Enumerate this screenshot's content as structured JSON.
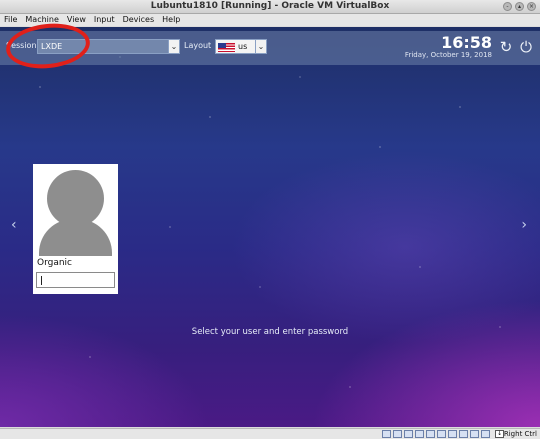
{
  "window": {
    "title": "Lubuntu1810 [Running] - Oracle VM VirtualBox"
  },
  "menubar": {
    "items": [
      "File",
      "Machine",
      "View",
      "Input",
      "Devices",
      "Help"
    ]
  },
  "login": {
    "session_label": "Session",
    "session_value": "LXDE",
    "layout_label": "Layout",
    "layout_value": "us",
    "clock_time": "16:58",
    "clock_date": "Friday, October 19, 2018",
    "username": "Organic",
    "prompt": "Select your user and enter password"
  },
  "statusbar": {
    "host_key": "Right Ctrl"
  },
  "colors": {
    "annotation": "#e0201a",
    "panel": "#6e82aa"
  }
}
